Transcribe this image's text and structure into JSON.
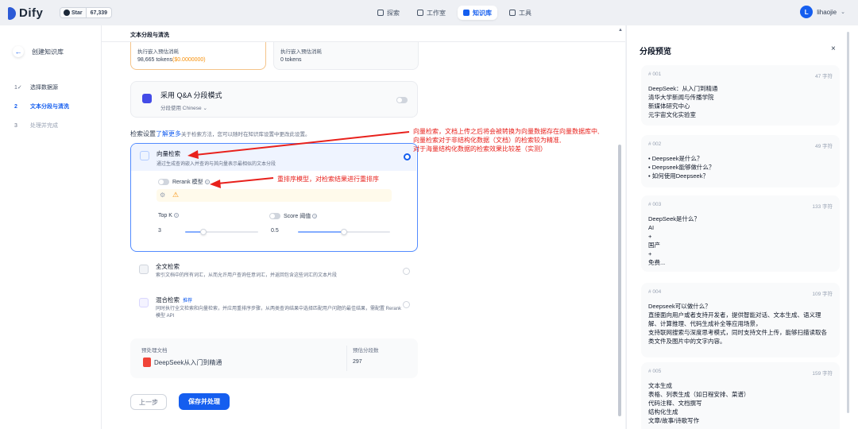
{
  "app": {
    "name": "Dify",
    "github_label": "Star",
    "star_count": "67,339"
  },
  "nav": [
    {
      "label": "探索",
      "active": false
    },
    {
      "label": "工作室",
      "active": false
    },
    {
      "label": "知识库",
      "active": true
    },
    {
      "label": "工具",
      "active": false
    }
  ],
  "user": {
    "initial": "L",
    "name": "lihaojie"
  },
  "sidebar": {
    "back_label": "创建知识库",
    "steps": [
      {
        "num": "1",
        "label": "选择数据源",
        "state": "done"
      },
      {
        "num": "2",
        "label": "文本分段与清洗",
        "state": "active"
      },
      {
        "num": "3",
        "label": "处理并完成",
        "state": "todo"
      }
    ]
  },
  "main": {
    "title": "文本分段与清洗",
    "estimate_a": {
      "label": "执行嵌入预估消耗",
      "tokens": "98,665 tokens",
      "money": "($0.0000000)"
    },
    "estimate_b": {
      "label": "执行嵌入预估消耗",
      "tokens": "0 tokens"
    },
    "qa": {
      "title": "采用 Q&A 分段模式",
      "sub": "分段使用 Chinese ⌄"
    },
    "search": {
      "heading": "检索设置",
      "link": "了解更多",
      "hint": "关于检索方法，您可以随时在知识库设置中更改此设置。"
    },
    "vector": {
      "title": "向量检索",
      "sub": "通过生成查询嵌入并查询与其向量表示最相似的文本分段",
      "rerank_label": "Rerank 模型",
      "topk_label": "Top K",
      "topk_value": "3",
      "topk_fraction": 0.25,
      "score_label": "Score 阈值",
      "score_value": "0.5",
      "score_fraction": 0.5
    },
    "fulltext": {
      "title": "全文检索",
      "sub": "索引文档中的所有词汇，从而允许用户查询任意词汇，并返回包含这些词汇的文本片段"
    },
    "hybrid": {
      "title": "混合检索",
      "badge": "推荐",
      "sub": "同时执行全文检索和向量检索，并应用重排序步骤，从两类查询结果中选择匹配用户问题的最佳结果，需配置 Rerank 模型 API"
    },
    "doc": {
      "label": "预处理文档",
      "name": "DeepSeek从入门到精通",
      "count_label": "预估分段数",
      "count": "297"
    },
    "prev_button": "上一步",
    "save_button": "保存并处理"
  },
  "annotations": {
    "vector_note": [
      "向量检索，文档上传之后将会被转换为向量数据存在向量数据库中,",
      "向量检索对于非结构化数据（文档）的检索较为精准,",
      "对于海量结构化数据的检索效果比较差（实测）"
    ],
    "rerank_note": "重排序模型，对检索结果进行重排序"
  },
  "preview": {
    "title": "分段预览",
    "close": "×",
    "chunks": [
      {
        "id": "# 001",
        "chars": "47 字符",
        "text": "DeepSeek：从入门到精通\n清华大学新闻与传播学院\n新媒体研究中心\n元宇宙文化实验室"
      },
      {
        "id": "# 002",
        "chars": "49 字符",
        "text": "• Deepseek是什么？\n• Deepseek能够做什么？\n• 如何使用Deepseek？"
      },
      {
        "id": "# 003",
        "chars": "133 字符",
        "text": "DeepSeek是什么？\nAI\n+\n国产\n+\n免费..."
      },
      {
        "id": "# 004",
        "chars": "109 字符",
        "text": "Deepseek可以做什么？\n直接面向用户或者支持开发者，提供智能对话、文本生成、语义理解、计算推理、代码生成补全等应用场景，\n支持联网搜索与深度思考模式，同时支持文件上传，能够扫描读取各类文件及图片中的文字内容。"
      },
      {
        "id": "# 005",
        "chars": "159 字符",
        "text": "文本生成\n表格、列表生成（如日程安排、菜谱）\n代码注释、文档撰写\n结构化生成\n文章/故事/诗歌写作"
      }
    ]
  }
}
